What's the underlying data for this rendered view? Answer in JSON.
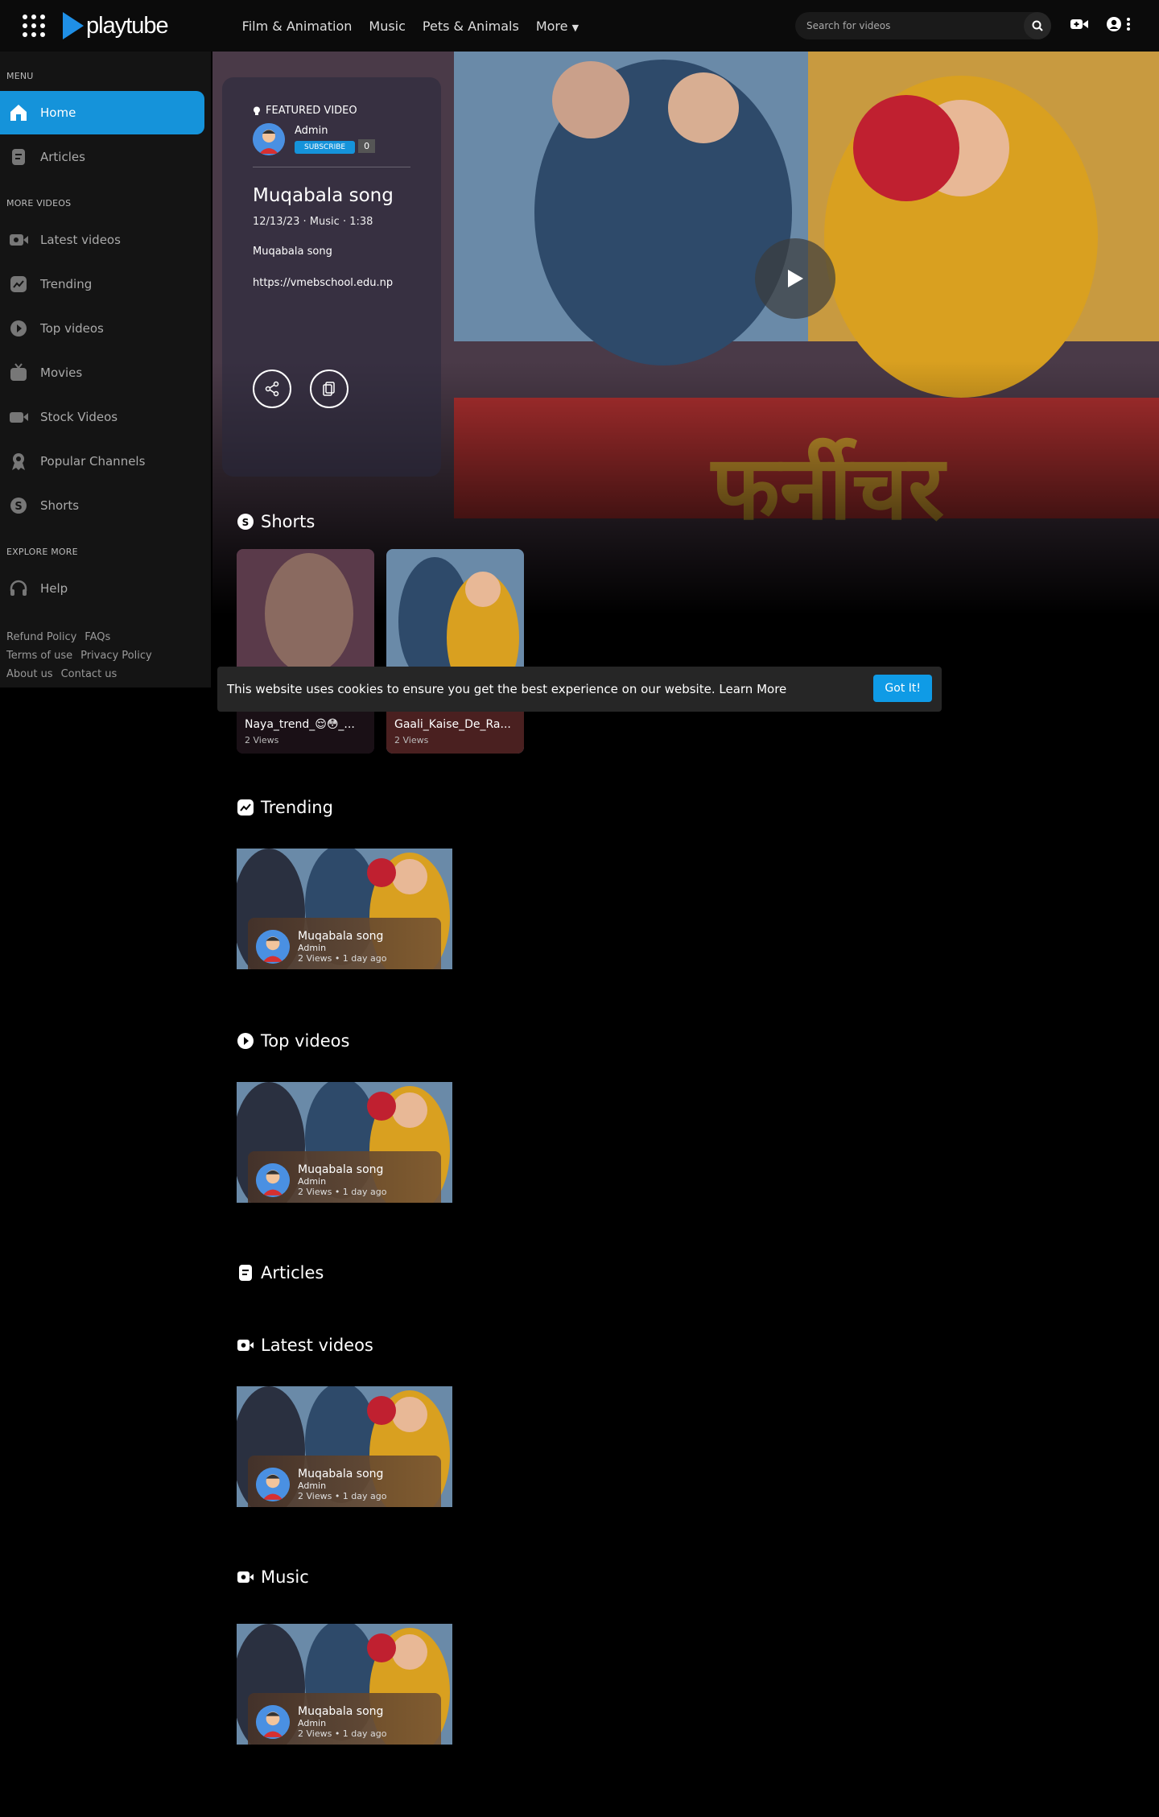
{
  "brand": {
    "name": "playtube",
    "accent": "#1593da"
  },
  "nav": [
    "Film & Animation",
    "Music",
    "Pets & Animals",
    "More"
  ],
  "search": {
    "placeholder": "Search for videos"
  },
  "sidebar": {
    "menu_heading": "MENU",
    "menu": [
      {
        "label": "Home",
        "icon": "home-icon"
      },
      {
        "label": "Articles",
        "icon": "article-icon"
      }
    ],
    "more_heading": "MORE VIDEOS",
    "more": [
      {
        "label": "Latest videos",
        "icon": "video-icon"
      },
      {
        "label": "Trending",
        "icon": "trending-icon"
      },
      {
        "label": "Top videos",
        "icon": "play-circle-icon"
      },
      {
        "label": "Movies",
        "icon": "movie-icon"
      },
      {
        "label": "Stock Videos",
        "icon": "camera-icon"
      },
      {
        "label": "Popular Channels",
        "icon": "badge-icon"
      },
      {
        "label": "Shorts",
        "icon": "shorts-icon"
      }
    ],
    "explore_heading": "EXPLORE MORE",
    "explore": [
      {
        "label": "Help",
        "icon": "headset-icon"
      }
    ],
    "links": [
      "Refund Policy",
      "FAQs",
      "Terms of use",
      "Privacy Policy",
      "About us",
      "Contact us"
    ]
  },
  "featured": {
    "label": "FEATURED VIDEO",
    "author": "Admin",
    "subscribe": "SUBSCRIBE",
    "sub_count": "0",
    "title": "Muqabala song",
    "date": "12/13/23",
    "category": "Music",
    "duration": "1:38",
    "description": "Muqabala song",
    "link": "https://vmebschool.edu.np"
  },
  "sections": {
    "shorts": "Shorts",
    "trending": "Trending",
    "top": "Top videos",
    "articles": "Articles",
    "latest": "Latest videos",
    "music": "Music"
  },
  "shorts": [
    {
      "title": "Naya_trend_😌😳_...",
      "views": "2 Views"
    },
    {
      "title": "Gaali_Kaise_De_Ra...",
      "views": "2 Views"
    }
  ],
  "video": {
    "title": "Muqabala song",
    "author": "Admin",
    "meta": "2 Views • 1 day ago"
  },
  "cookie": {
    "text": "This website uses cookies to ensure you get the best experience on our website.",
    "learn": "Learn More",
    "button": "Got It!"
  }
}
